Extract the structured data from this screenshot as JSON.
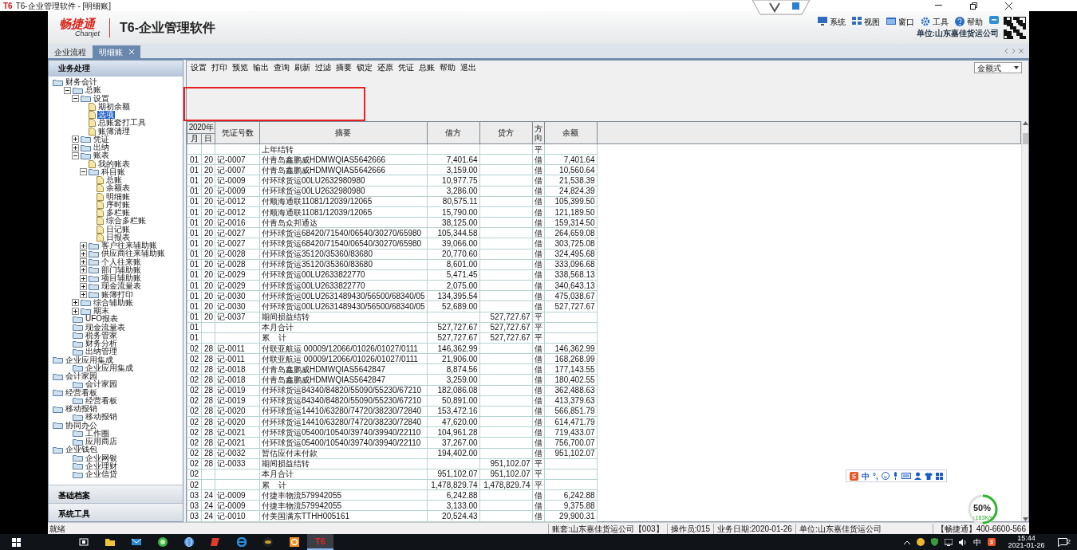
{
  "window": {
    "badge": "T6",
    "title": "T6-企业管理软件 - [明细账]"
  },
  "header": {
    "logo_cn": "畅捷通",
    "logo_en": "Chanjet",
    "product": "T6-企业管理软件",
    "menu": [
      {
        "label": "系统"
      },
      {
        "label": "视图"
      },
      {
        "label": "窗口"
      },
      {
        "label": "工具"
      },
      {
        "label": "帮助"
      }
    ],
    "unit": "单位:山东嘉佳货运公司"
  },
  "tabs": [
    {
      "label": "企业流程",
      "selected": false,
      "closable": false
    },
    {
      "label": "明细账",
      "selected": true,
      "closable": true
    }
  ],
  "sidebar": {
    "title": "业务处理",
    "tree": [
      {
        "label": "财务会计",
        "kind": "folder",
        "selected": false,
        "children": [
          {
            "label": "总账",
            "kind": "folder",
            "expanded": true,
            "selected": false,
            "children": [
              {
                "label": "设置",
                "kind": "folder",
                "expanded": true,
                "selected": false,
                "children": [
                  {
                    "label": "期初余额",
                    "kind": "doc",
                    "selected": false
                  },
                  {
                    "label": "选项",
                    "kind": "doc",
                    "selected": true
                  },
                  {
                    "label": "总账套打工具",
                    "kind": "doc",
                    "selected": false
                  },
                  {
                    "label": "账簿清理",
                    "kind": "doc",
                    "selected": false
                  }
                ]
              },
              {
                "label": "凭证",
                "kind": "folder",
                "expanded": false,
                "selected": false
              },
              {
                "label": "出纳",
                "kind": "folder",
                "expanded": false,
                "selected": false
              },
              {
                "label": "账表",
                "kind": "folder",
                "expanded": true,
                "selected": false,
                "children": [
                  {
                    "label": "我的账表",
                    "kind": "doc",
                    "selected": false
                  },
                  {
                    "label": "科目账",
                    "kind": "folder",
                    "expanded": true,
                    "selected": false,
                    "children": [
                      {
                        "label": "总账",
                        "kind": "doc",
                        "selected": false
                      },
                      {
                        "label": "余额表",
                        "kind": "doc",
                        "selected": false
                      },
                      {
                        "label": "明细账",
                        "kind": "doc",
                        "selected": false
                      },
                      {
                        "label": "序时账",
                        "kind": "doc",
                        "selected": false
                      },
                      {
                        "label": "多栏账",
                        "kind": "doc",
                        "selected": false
                      },
                      {
                        "label": "综合多栏账",
                        "kind": "doc",
                        "selected": false
                      },
                      {
                        "label": "日记账",
                        "kind": "doc",
                        "selected": false
                      },
                      {
                        "label": "日报表",
                        "kind": "doc",
                        "selected": false
                      }
                    ]
                  },
                  {
                    "label": "客户往来辅助账",
                    "kind": "folder",
                    "expanded": false,
                    "selected": false
                  },
                  {
                    "label": "供应商往来辅助账",
                    "kind": "folder",
                    "expanded": false,
                    "selected": false
                  },
                  {
                    "label": "个人往来账",
                    "kind": "folder",
                    "expanded": false,
                    "selected": false
                  },
                  {
                    "label": "部门辅助账",
                    "kind": "folder",
                    "expanded": false,
                    "selected": false
                  },
                  {
                    "label": "项目辅助账",
                    "kind": "folder",
                    "expanded": false,
                    "selected": false
                  },
                  {
                    "label": "现金流量表",
                    "kind": "folder",
                    "expanded": false,
                    "selected": false
                  },
                  {
                    "label": "账簿打印",
                    "kind": "folder",
                    "expanded": false,
                    "selected": false
                  }
                ]
              },
              {
                "label": "综合辅助账",
                "kind": "folder",
                "expanded": false,
                "selected": false
              },
              {
                "label": "期末",
                "kind": "folder",
                "expanded": false,
                "selected": false
              }
            ]
          },
          {
            "label": "UFO报表",
            "kind": "folder",
            "selected": false
          },
          {
            "label": "现金流量表",
            "kind": "folder",
            "selected": false
          },
          {
            "label": "税务管家",
            "kind": "folder",
            "selected": false
          },
          {
            "label": "财务分析",
            "kind": "folder",
            "selected": false
          },
          {
            "label": "出纳管理",
            "kind": "folder",
            "selected": false
          }
        ]
      },
      {
        "label": "企业应用集成",
        "kind": "folder",
        "selected": false,
        "children": [
          {
            "label": "企业应用集成",
            "kind": "folder",
            "selected": false
          }
        ]
      },
      {
        "label": "会计家园",
        "kind": "folder",
        "selected": false,
        "children": [
          {
            "label": "会计家园",
            "kind": "folder",
            "selected": false
          }
        ]
      },
      {
        "label": "经营看板",
        "kind": "folder",
        "selected": false,
        "children": [
          {
            "label": "经营看板",
            "kind": "folder",
            "selected": false
          }
        ]
      },
      {
        "label": "移动报销",
        "kind": "folder",
        "selected": false,
        "children": [
          {
            "label": "移动报销",
            "kind": "folder",
            "selected": false
          }
        ]
      },
      {
        "label": "协同办公",
        "kind": "folder",
        "selected": false,
        "children": [
          {
            "label": "工作圈",
            "kind": "folder",
            "selected": false
          },
          {
            "label": "应用商店",
            "kind": "folder",
            "selected": false
          }
        ]
      },
      {
        "label": "企业钱包",
        "kind": "folder",
        "selected": false,
        "children": [
          {
            "label": "企业网银",
            "kind": "folder",
            "selected": false
          },
          {
            "label": "企业理财",
            "kind": "folder",
            "selected": false
          },
          {
            "label": "企业信贷",
            "kind": "folder",
            "selected": false
          }
        ]
      }
    ],
    "sections": [
      "基础档案",
      "系统工具"
    ]
  },
  "toolbar": {
    "buttons": [
      "设置",
      "打印",
      "预览",
      "输出",
      "查询",
      "刷新",
      "过滤",
      "摘要",
      "锁定",
      "还原",
      "凭证",
      "总账",
      "帮助",
      "退出"
    ],
    "format_select": "金额式"
  },
  "ledger": {
    "year": "2020年",
    "month_col": "月",
    "day_col": "日",
    "columns": [
      "凭证号数",
      "摘要",
      "借方",
      "贷方",
      "方向",
      "余额"
    ],
    "rows": [
      {
        "summary": "上年结转",
        "dir": "平"
      },
      {
        "m": "01",
        "d": "20",
        "no": "记-0007",
        "summary": "付青岛鑫鹏威HDMWQIAS5642666",
        "debit": "7,401.64",
        "dir": "借",
        "balance": "7,401.64"
      },
      {
        "m": "01",
        "d": "20",
        "no": "记-0007",
        "summary": "付青岛鑫鹏威HDMWQIAS5642666",
        "debit": "3,159.00",
        "dir": "借",
        "balance": "10,560.64"
      },
      {
        "m": "01",
        "d": "20",
        "no": "记-0009",
        "summary": "付环球货运00LU2632980980",
        "debit": "10,977.75",
        "dir": "借",
        "balance": "21,538.39"
      },
      {
        "m": "01",
        "d": "20",
        "no": "记-0009",
        "summary": "付环球货运00LU2632980980",
        "debit": "3,286.00",
        "dir": "借",
        "balance": "24,824.39"
      },
      {
        "m": "01",
        "d": "20",
        "no": "记-0012",
        "summary": "付顺海通联11081/12039/12065",
        "debit": "80,575.11",
        "dir": "借",
        "balance": "105,399.50"
      },
      {
        "m": "01",
        "d": "20",
        "no": "记-0012",
        "summary": "付顺海通联11081/12039/12065",
        "debit": "15,790.00",
        "dir": "借",
        "balance": "121,189.50"
      },
      {
        "m": "01",
        "d": "20",
        "no": "记-0016",
        "summary": "付青岛众邦通达",
        "debit": "38,125.00",
        "dir": "借",
        "balance": "159,314.50"
      },
      {
        "m": "01",
        "d": "20",
        "no": "记-0027",
        "summary": "付环球货运68420/71540/06540/30270/65980",
        "debit": "105,344.58",
        "dir": "借",
        "balance": "264,659.08"
      },
      {
        "m": "01",
        "d": "20",
        "no": "记-0027",
        "summary": "付环球货运68420/71540/06540/30270/65980",
        "debit": "39,066.00",
        "dir": "借",
        "balance": "303,725.08"
      },
      {
        "m": "01",
        "d": "20",
        "no": "记-0028",
        "summary": "付环球货运35120/35360/83680",
        "debit": "20,770.60",
        "dir": "借",
        "balance": "324,495.68"
      },
      {
        "m": "01",
        "d": "20",
        "no": "记-0028",
        "summary": "付环球货运35120/35360/83680",
        "debit": "8,601.00",
        "dir": "借",
        "balance": "333,096.68"
      },
      {
        "m": "01",
        "d": "20",
        "no": "记-0029",
        "summary": "付环球货运00LU2633822770",
        "debit": "5,471.45",
        "dir": "借",
        "balance": "338,568.13"
      },
      {
        "m": "01",
        "d": "20",
        "no": "记-0029",
        "summary": "付环球货运00LU2633822770",
        "debit": "2,075.00",
        "dir": "借",
        "balance": "340,643.13"
      },
      {
        "m": "01",
        "d": "20",
        "no": "记-0030",
        "summary": "付环球货运00LU2631489430/56500/68340/05",
        "debit": "134,395.54",
        "dir": "借",
        "balance": "475,038.67"
      },
      {
        "m": "01",
        "d": "20",
        "no": "记-0030",
        "summary": "付环球货运00LU2631489430/56500/68340/05",
        "debit": "52,689.00",
        "dir": "借",
        "balance": "527,727.67"
      },
      {
        "m": "01",
        "d": "20",
        "no": "记-0037",
        "summary": "期间损益结转",
        "credit": "527,727.67",
        "dir": "平"
      },
      {
        "m": "01",
        "summary": "本月合计",
        "debit": "527,727.67",
        "credit": "527,727.67",
        "dir": "平"
      },
      {
        "m": "01",
        "summary": "累    计",
        "debit": "527,727.67",
        "credit": "527,727.67",
        "dir": "平"
      },
      {
        "m": "02",
        "d": "28",
        "no": "记-0011",
        "summary": "付联亚航运 00009/12066/01026/01027/0111",
        "debit": "146,362.99",
        "dir": "借",
        "balance": "146,362.99"
      },
      {
        "m": "02",
        "d": "28",
        "no": "记-0011",
        "summary": "付联亚航运 00009/12066/01026/01027/0111",
        "debit": "21,906.00",
        "dir": "借",
        "balance": "168,268.99"
      },
      {
        "m": "02",
        "d": "28",
        "no": "记-0018",
        "summary": "付青岛鑫鹏威HDMWQIAS5642847",
        "debit": "8,874.56",
        "dir": "借",
        "balance": "177,143.55"
      },
      {
        "m": "02",
        "d": "28",
        "no": "记-0018",
        "summary": "付青岛鑫鹏威HDMWQIAS5642847",
        "debit": "3,259.00",
        "dir": "借",
        "balance": "180,402.55"
      },
      {
        "m": "02",
        "d": "28",
        "no": "记-0019",
        "summary": "付环球货运84340/84820/55090/55230/67210",
        "debit": "182,086.08",
        "dir": "借",
        "balance": "362,488.63"
      },
      {
        "m": "02",
        "d": "28",
        "no": "记-0019",
        "summary": "付环球货运84340/84820/55090/55230/67210",
        "debit": "50,891.00",
        "dir": "借",
        "balance": "413,379.63"
      },
      {
        "m": "02",
        "d": "28",
        "no": "记-0020",
        "summary": "付环球货运14410/63280/74720/38230/72840",
        "debit": "153,472.16",
        "dir": "借",
        "balance": "566,851.79"
      },
      {
        "m": "02",
        "d": "28",
        "no": "记-0020",
        "summary": "付环球货运14410/63280/74720/38230/72840",
        "debit": "47,620.00",
        "dir": "借",
        "balance": "614,471.79"
      },
      {
        "m": "02",
        "d": "28",
        "no": "记-0021",
        "summary": "付环球货运05400/10540/39740/39940/22110",
        "debit": "104,961.28",
        "dir": "借",
        "balance": "719,433.07"
      },
      {
        "m": "02",
        "d": "28",
        "no": "记-0021",
        "summary": "付环球货运05400/10540/39740/39940/22110",
        "debit": "37,267.00",
        "dir": "借",
        "balance": "756,700.07"
      },
      {
        "m": "02",
        "d": "28",
        "no": "记-0032",
        "summary": "暂估应付未付款",
        "debit": "194,402.00",
        "dir": "借",
        "balance": "951,102.07"
      },
      {
        "m": "02",
        "d": "28",
        "no": "记-0033",
        "summary": "期间损益结转",
        "credit": "951,102.07",
        "dir": "平"
      },
      {
        "m": "02",
        "summary": "本月合计",
        "debit": "951,102.07",
        "credit": "951,102.07",
        "dir": "平"
      },
      {
        "m": "02",
        "summary": "累    计",
        "debit": "1,478,829.74",
        "credit": "1,478,829.74",
        "dir": "平"
      },
      {
        "m": "03",
        "d": "24",
        "no": "记-0009",
        "summary": "付捷丰物流579942055",
        "debit": "6,242.88",
        "dir": "借",
        "balance": "6,242.88"
      },
      {
        "m": "03",
        "d": "24",
        "no": "记-0009",
        "summary": "付捷丰物流579942055",
        "debit": "3,133.00",
        "dir": "借",
        "balance": "9,375.88"
      },
      {
        "m": "03",
        "d": "24",
        "no": "记-0010",
        "summary": "付美国满东TTHH005161",
        "debit": "20,524.43",
        "dir": "借",
        "balance": "29,900.31"
      }
    ]
  },
  "status_bar": {
    "ready": "就绪",
    "items": [
      "账套:山东嘉佳货运公司【003】",
      "操作员:015",
      "业务日期:2020-01-26",
      "单位:山东嘉佳货运公司",
      "【畅捷通】400-6600-566"
    ]
  },
  "ime_bar": {
    "mode": "中",
    "punct": "°,"
  },
  "network_meter": {
    "level": 0.5,
    "reading": "50%",
    "speed": "↑163K/s"
  },
  "taskbar": {
    "apps": [
      {
        "active": false
      },
      {
        "active": false
      },
      {
        "active": false
      },
      {
        "active": false
      },
      {
        "active": false
      },
      {
        "active": false
      },
      {
        "active": false
      },
      {
        "active": false
      },
      {
        "active": false
      },
      {
        "label": "T6",
        "active": true
      }
    ],
    "ime": "中",
    "time": "15:44",
    "date": "2021-01-26",
    "notifications": "2"
  }
}
